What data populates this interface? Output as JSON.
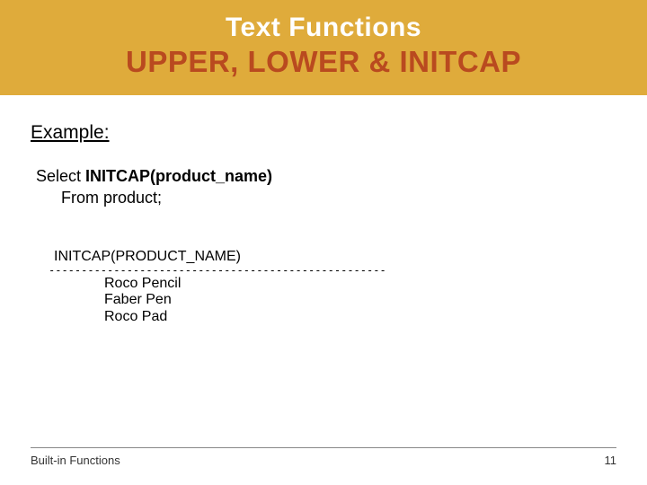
{
  "banner": {
    "title": "Text Functions",
    "subtitle": "UPPER, LOWER & INITCAP"
  },
  "example_label": "Example:",
  "sql": {
    "select_word": "Select ",
    "func_call": "INITCAP(product_name)",
    "from_line": "From product;"
  },
  "output": {
    "header": "INITCAP(PRODUCT_NAME)",
    "separator": "----------------------------------------------------",
    "rows": [
      "Roco Pencil",
      "Faber Pen",
      "Roco Pad"
    ]
  },
  "footer": {
    "left": "Built-in Functions",
    "right": "11"
  }
}
